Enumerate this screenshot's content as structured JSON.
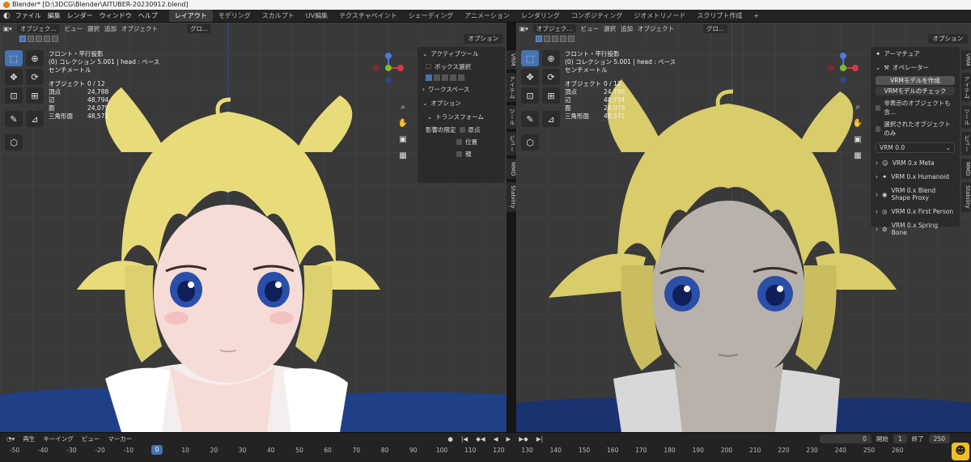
{
  "title": "Blender* [D:\\3DCG\\Blender\\AITUBER-20230912.blend]",
  "menu": [
    "ファイル",
    "編集",
    "レンダー",
    "ウィンドウ",
    "ヘルプ"
  ],
  "workspaces": [
    "レイアウト",
    "モデリング",
    "スカルプト",
    "UV編集",
    "テクスチャペイント",
    "シェーディング",
    "アニメーション",
    "レンダリング",
    "コンポジティング",
    "ジオメトリノード",
    "スクリプト作成",
    "+"
  ],
  "viewport_header": {
    "mode": "オブジェク...",
    "view": "ビュー",
    "select": "選択",
    "add": "追加",
    "object": "オブジェクト",
    "global": "グロ...",
    "options": "オプション"
  },
  "overlay": {
    "projection": "フロント・平行投影",
    "collection": "(0) コレクション 5.001 | head : ベース",
    "unit": "センチメートル"
  },
  "stats": [
    {
      "label": "オブジェクト",
      "value": "0 / 12"
    },
    {
      "label": "頂点",
      "value": "24,788"
    },
    {
      "label": "辺",
      "value": "48,794"
    },
    {
      "label": "面",
      "value": "24,079"
    },
    {
      "label": "三角形面",
      "value": "48,572"
    }
  ],
  "left_npanel": {
    "active_tool": "アクティブツール",
    "box_select": "ボックス選択",
    "workspace": "ワークスペース",
    "options": "オプション",
    "transform": "トランスフォーム",
    "affect_only": "影響の限定",
    "checks": [
      "原点",
      "位置",
      "親"
    ]
  },
  "left_tabs": [
    "VRM",
    "アイテム",
    "ツール",
    "ビュー",
    "MMD",
    "Stability"
  ],
  "right_tabs": [
    "VRM",
    "アイテム",
    "ツール",
    "ビュー",
    "MMD",
    "Stability"
  ],
  "vrm_panel": {
    "armature": "アーマチュア",
    "operator": "オペレーター",
    "create": "VRMモデルを作成",
    "check": "VRMモデルのチェック",
    "check_hidden": "非表示のオブジェクトも含...",
    "check_selected": "選択されたオブジェクトのみ",
    "version": "VRM 0.0",
    "items": [
      "VRM 0.x Meta",
      "VRM 0.x Humanoid",
      "VRM 0.x Blend Shape Proxy",
      "VRM 0.x First Person",
      "VRM 0.x Spring Bone"
    ]
  },
  "timeline": {
    "play": "再生",
    "keying": "キーイング",
    "view": "ビュー",
    "marker": "マーカー",
    "current_frame": "0",
    "start_label": "開始",
    "start": "1",
    "end_label": "終了",
    "end": "250",
    "ticks": [
      "-50",
      "-40",
      "-30",
      "-20",
      "-10",
      "0",
      "10",
      "20",
      "30",
      "40",
      "50",
      "60",
      "70",
      "80",
      "90",
      "100",
      "110",
      "120",
      "130",
      "140",
      "150",
      "160",
      "170",
      "180",
      "190",
      "200",
      "210",
      "220",
      "230",
      "240",
      "250",
      "260"
    ]
  },
  "colors": {
    "accent": "#4772b3",
    "hair": "#e8dc7a",
    "skin_left": "#f6dcd6",
    "skin_right": "#b9b2aa",
    "jacket": "#1f3f86"
  }
}
